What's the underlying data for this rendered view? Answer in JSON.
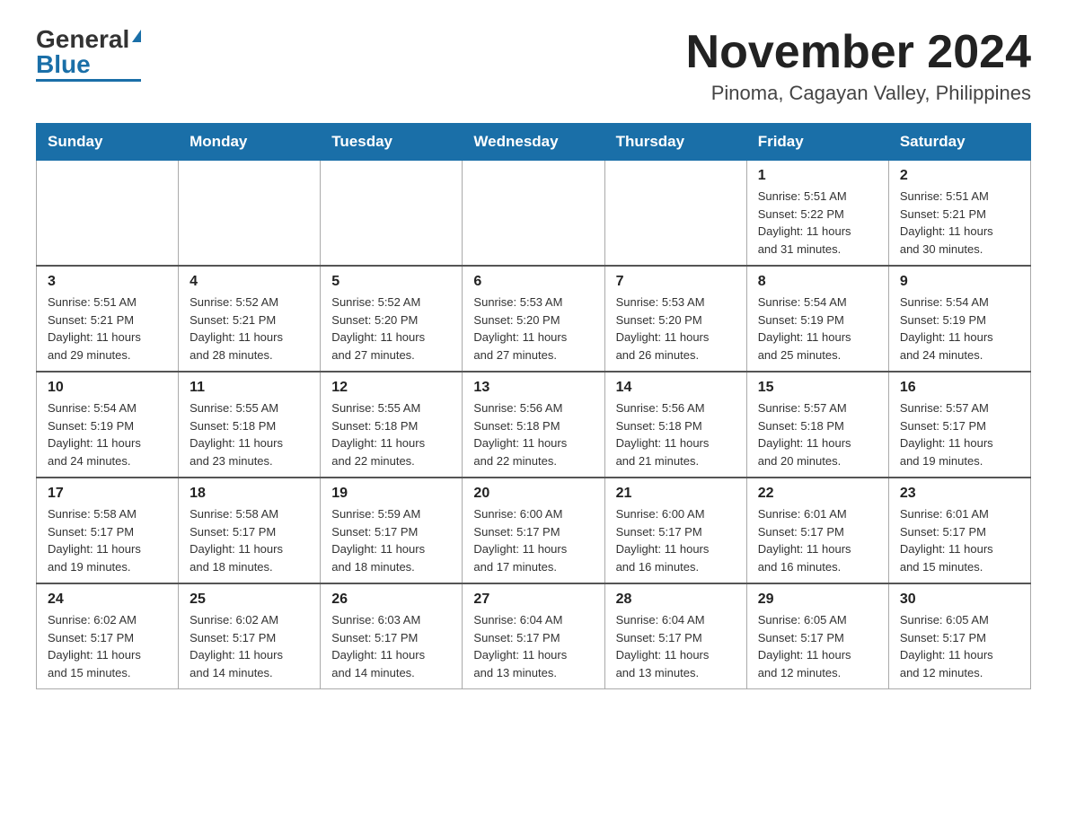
{
  "header": {
    "logo_general": "General",
    "logo_blue": "Blue",
    "month_title": "November 2024",
    "location": "Pinoma, Cagayan Valley, Philippines"
  },
  "days_of_week": [
    "Sunday",
    "Monday",
    "Tuesday",
    "Wednesday",
    "Thursday",
    "Friday",
    "Saturday"
  ],
  "weeks": [
    [
      {
        "day": "",
        "info": ""
      },
      {
        "day": "",
        "info": ""
      },
      {
        "day": "",
        "info": ""
      },
      {
        "day": "",
        "info": ""
      },
      {
        "day": "",
        "info": ""
      },
      {
        "day": "1",
        "info": "Sunrise: 5:51 AM\nSunset: 5:22 PM\nDaylight: 11 hours\nand 31 minutes."
      },
      {
        "day": "2",
        "info": "Sunrise: 5:51 AM\nSunset: 5:21 PM\nDaylight: 11 hours\nand 30 minutes."
      }
    ],
    [
      {
        "day": "3",
        "info": "Sunrise: 5:51 AM\nSunset: 5:21 PM\nDaylight: 11 hours\nand 29 minutes."
      },
      {
        "day": "4",
        "info": "Sunrise: 5:52 AM\nSunset: 5:21 PM\nDaylight: 11 hours\nand 28 minutes."
      },
      {
        "day": "5",
        "info": "Sunrise: 5:52 AM\nSunset: 5:20 PM\nDaylight: 11 hours\nand 27 minutes."
      },
      {
        "day": "6",
        "info": "Sunrise: 5:53 AM\nSunset: 5:20 PM\nDaylight: 11 hours\nand 27 minutes."
      },
      {
        "day": "7",
        "info": "Sunrise: 5:53 AM\nSunset: 5:20 PM\nDaylight: 11 hours\nand 26 minutes."
      },
      {
        "day": "8",
        "info": "Sunrise: 5:54 AM\nSunset: 5:19 PM\nDaylight: 11 hours\nand 25 minutes."
      },
      {
        "day": "9",
        "info": "Sunrise: 5:54 AM\nSunset: 5:19 PM\nDaylight: 11 hours\nand 24 minutes."
      }
    ],
    [
      {
        "day": "10",
        "info": "Sunrise: 5:54 AM\nSunset: 5:19 PM\nDaylight: 11 hours\nand 24 minutes."
      },
      {
        "day": "11",
        "info": "Sunrise: 5:55 AM\nSunset: 5:18 PM\nDaylight: 11 hours\nand 23 minutes."
      },
      {
        "day": "12",
        "info": "Sunrise: 5:55 AM\nSunset: 5:18 PM\nDaylight: 11 hours\nand 22 minutes."
      },
      {
        "day": "13",
        "info": "Sunrise: 5:56 AM\nSunset: 5:18 PM\nDaylight: 11 hours\nand 22 minutes."
      },
      {
        "day": "14",
        "info": "Sunrise: 5:56 AM\nSunset: 5:18 PM\nDaylight: 11 hours\nand 21 minutes."
      },
      {
        "day": "15",
        "info": "Sunrise: 5:57 AM\nSunset: 5:18 PM\nDaylight: 11 hours\nand 20 minutes."
      },
      {
        "day": "16",
        "info": "Sunrise: 5:57 AM\nSunset: 5:17 PM\nDaylight: 11 hours\nand 19 minutes."
      }
    ],
    [
      {
        "day": "17",
        "info": "Sunrise: 5:58 AM\nSunset: 5:17 PM\nDaylight: 11 hours\nand 19 minutes."
      },
      {
        "day": "18",
        "info": "Sunrise: 5:58 AM\nSunset: 5:17 PM\nDaylight: 11 hours\nand 18 minutes."
      },
      {
        "day": "19",
        "info": "Sunrise: 5:59 AM\nSunset: 5:17 PM\nDaylight: 11 hours\nand 18 minutes."
      },
      {
        "day": "20",
        "info": "Sunrise: 6:00 AM\nSunset: 5:17 PM\nDaylight: 11 hours\nand 17 minutes."
      },
      {
        "day": "21",
        "info": "Sunrise: 6:00 AM\nSunset: 5:17 PM\nDaylight: 11 hours\nand 16 minutes."
      },
      {
        "day": "22",
        "info": "Sunrise: 6:01 AM\nSunset: 5:17 PM\nDaylight: 11 hours\nand 16 minutes."
      },
      {
        "day": "23",
        "info": "Sunrise: 6:01 AM\nSunset: 5:17 PM\nDaylight: 11 hours\nand 15 minutes."
      }
    ],
    [
      {
        "day": "24",
        "info": "Sunrise: 6:02 AM\nSunset: 5:17 PM\nDaylight: 11 hours\nand 15 minutes."
      },
      {
        "day": "25",
        "info": "Sunrise: 6:02 AM\nSunset: 5:17 PM\nDaylight: 11 hours\nand 14 minutes."
      },
      {
        "day": "26",
        "info": "Sunrise: 6:03 AM\nSunset: 5:17 PM\nDaylight: 11 hours\nand 14 minutes."
      },
      {
        "day": "27",
        "info": "Sunrise: 6:04 AM\nSunset: 5:17 PM\nDaylight: 11 hours\nand 13 minutes."
      },
      {
        "day": "28",
        "info": "Sunrise: 6:04 AM\nSunset: 5:17 PM\nDaylight: 11 hours\nand 13 minutes."
      },
      {
        "day": "29",
        "info": "Sunrise: 6:05 AM\nSunset: 5:17 PM\nDaylight: 11 hours\nand 12 minutes."
      },
      {
        "day": "30",
        "info": "Sunrise: 6:05 AM\nSunset: 5:17 PM\nDaylight: 11 hours\nand 12 minutes."
      }
    ]
  ]
}
